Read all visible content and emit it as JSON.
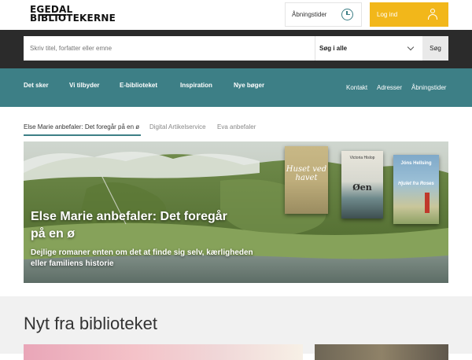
{
  "header": {
    "logo_line1": "EGEDAL",
    "logo_line2": "BIBLIOTEKERNE",
    "open_hours_label": "Åbningstider",
    "login_label": "Log ind",
    "accent_color": "#f2b71a"
  },
  "search": {
    "placeholder": "Skriv titel, forfatter eller emne",
    "scope_selected": "Søg i alle",
    "button_label": "Søg"
  },
  "nav": {
    "color": "#3d7f86",
    "items": [
      {
        "label": "Det sker"
      },
      {
        "label": "Vi tilbyder"
      },
      {
        "label": "E-biblioteket"
      },
      {
        "label": "Inspiration"
      },
      {
        "label": "Nye bøger"
      }
    ],
    "utility": [
      {
        "label": "Kontakt"
      },
      {
        "label": "Adresser"
      },
      {
        "label": "Åbningstider"
      }
    ]
  },
  "tabs": [
    {
      "label": "Else Marie anbefaler: Det foregår på en ø",
      "active": true
    },
    {
      "label": "Digital Artikelservice",
      "active": false
    },
    {
      "label": "Eva anbefaler",
      "active": false
    }
  ],
  "hero": {
    "title": "Else Marie anbefaler: Det foregår på en ø",
    "subtitle": "Dejlige romaner enten om det at finde sig selv, kærligheden eller familiens historie",
    "books": [
      {
        "title": "Huset ved havet",
        "author": ""
      },
      {
        "title": "Øen",
        "author": "Victoria Hislop"
      },
      {
        "title": "Hjulet fra Roses",
        "author": "Jóns Hellsing"
      }
    ]
  },
  "section": {
    "title": "Nyt fra biblioteket"
  }
}
